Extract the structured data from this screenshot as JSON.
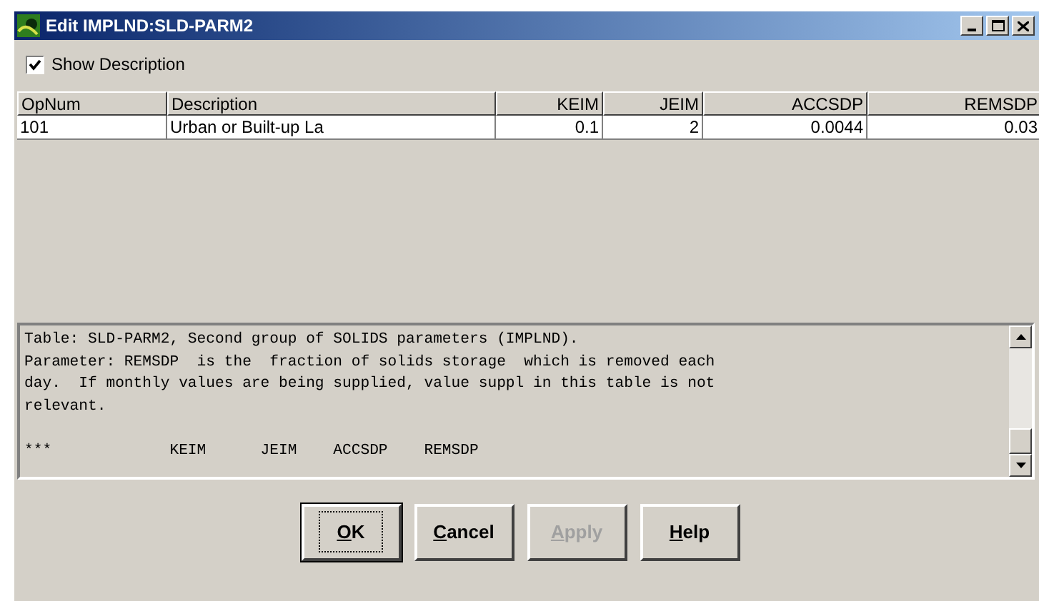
{
  "window": {
    "title": "Edit IMPLND:SLD-PARM2"
  },
  "show_description": {
    "label": "Show Description",
    "checked": true
  },
  "table": {
    "columns": [
      "OpNum",
      "Description",
      "KEIM",
      "JEIM",
      "ACCSDP",
      "REMSDP"
    ],
    "rows": [
      [
        "101",
        "Urban or Built-up La",
        "0.1",
        "2",
        "0.0044",
        "0.03"
      ]
    ]
  },
  "description_lines": [
    "Table: SLD-PARM2, Second group of SOLIDS parameters (IMPLND).",
    "Parameter: REMSDP  is the  fraction of solids storage  which is removed each",
    "day.  If monthly values are being supplied, value suppl in this table is not",
    "relevant."
  ],
  "column_line": "***             KEIM      JEIM    ACCSDP    REMSDP",
  "buttons": [
    {
      "label": "OK",
      "default": true,
      "disabled": false
    },
    {
      "label": "Cancel",
      "default": false,
      "disabled": false
    },
    {
      "label": "Apply",
      "default": false,
      "disabled": true
    },
    {
      "label": "Help",
      "default": false,
      "disabled": false
    }
  ]
}
